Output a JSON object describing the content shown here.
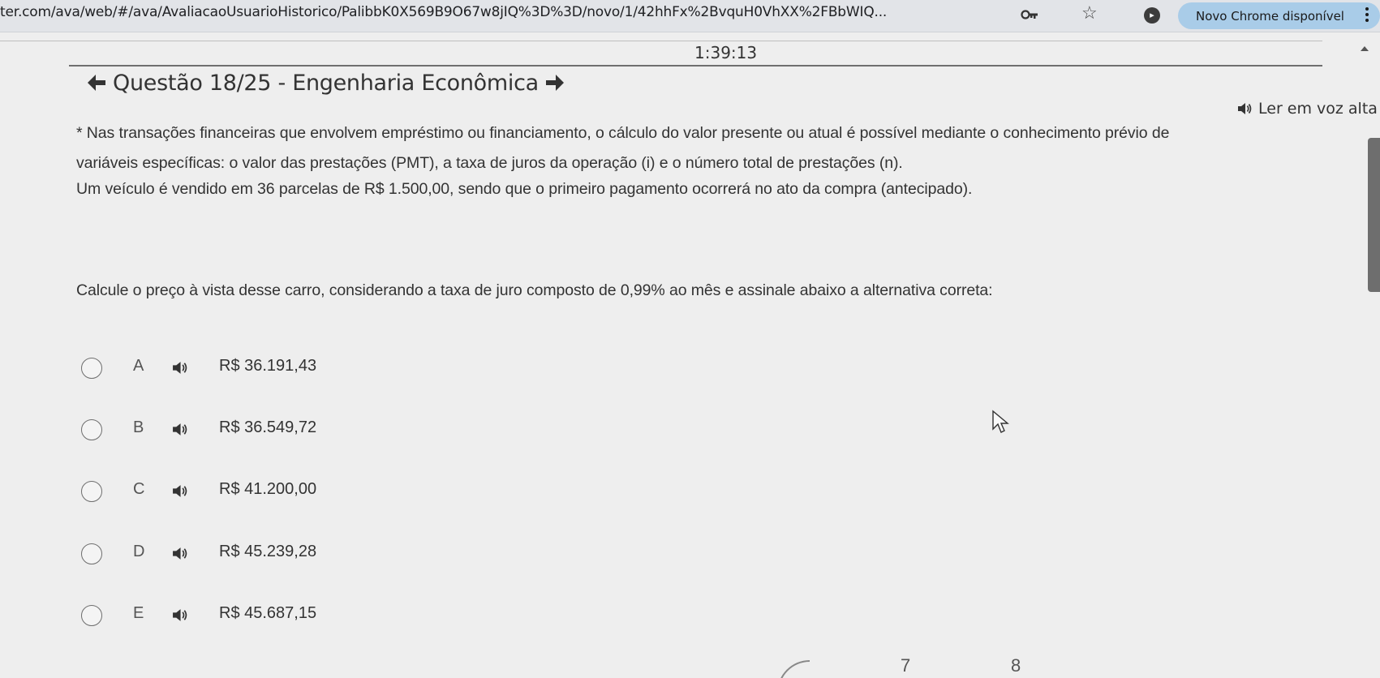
{
  "browser": {
    "url": "ter.com/ava/web/#/ava/AvaliacaoUsuarioHistorico/PalibbK0X569B9O67w8jIQ%3D%3D/novo/1/42hhFx%2BvquH0VhXX%2FBbWIQ...",
    "chrome_update_label": "Novo Chrome disponível",
    "icons": [
      "key-icon",
      "star-icon",
      "extension-icon",
      "menu-dots-icon"
    ]
  },
  "timer": "1:39:13",
  "question": {
    "title": "Questão 18/25 - Engenharia Econômica",
    "read_aloud_label": "Ler em voz alta",
    "paragraphs": [
      "* Nas transações financeiras que envolvem empréstimo ou financiamento, o cálculo do valor presente ou atual é possível mediante o conhecimento prévio de",
      "variáveis específicas: o valor das prestações (PMT), a taxa de juros da operação (i) e o número total de prestações (n).",
      "Um veículo é vendido em 36 parcelas de R$ 1.500,00, sendo que o primeiro pagamento ocorrerá no ato da compra (antecipado).",
      "Calcule o preço à vista desse carro, considerando a taxa de juro composto de 0,99% ao mês e assinale abaixo a alternativa correta:"
    ],
    "options": [
      {
        "letter": "A",
        "text": "R$ 36.191,43"
      },
      {
        "letter": "B",
        "text": "R$ 36.549,72"
      },
      {
        "letter": "C",
        "text": "R$ 41.200,00"
      },
      {
        "letter": "D",
        "text": "R$ 45.239,28"
      },
      {
        "letter": "E",
        "text": "R$ 45.687,15"
      }
    ]
  },
  "pagination_visible": [
    "7",
    "8"
  ],
  "colors": {
    "background": "#eeeeee",
    "text": "#333333",
    "chrome_pill": "#a9cce8"
  }
}
